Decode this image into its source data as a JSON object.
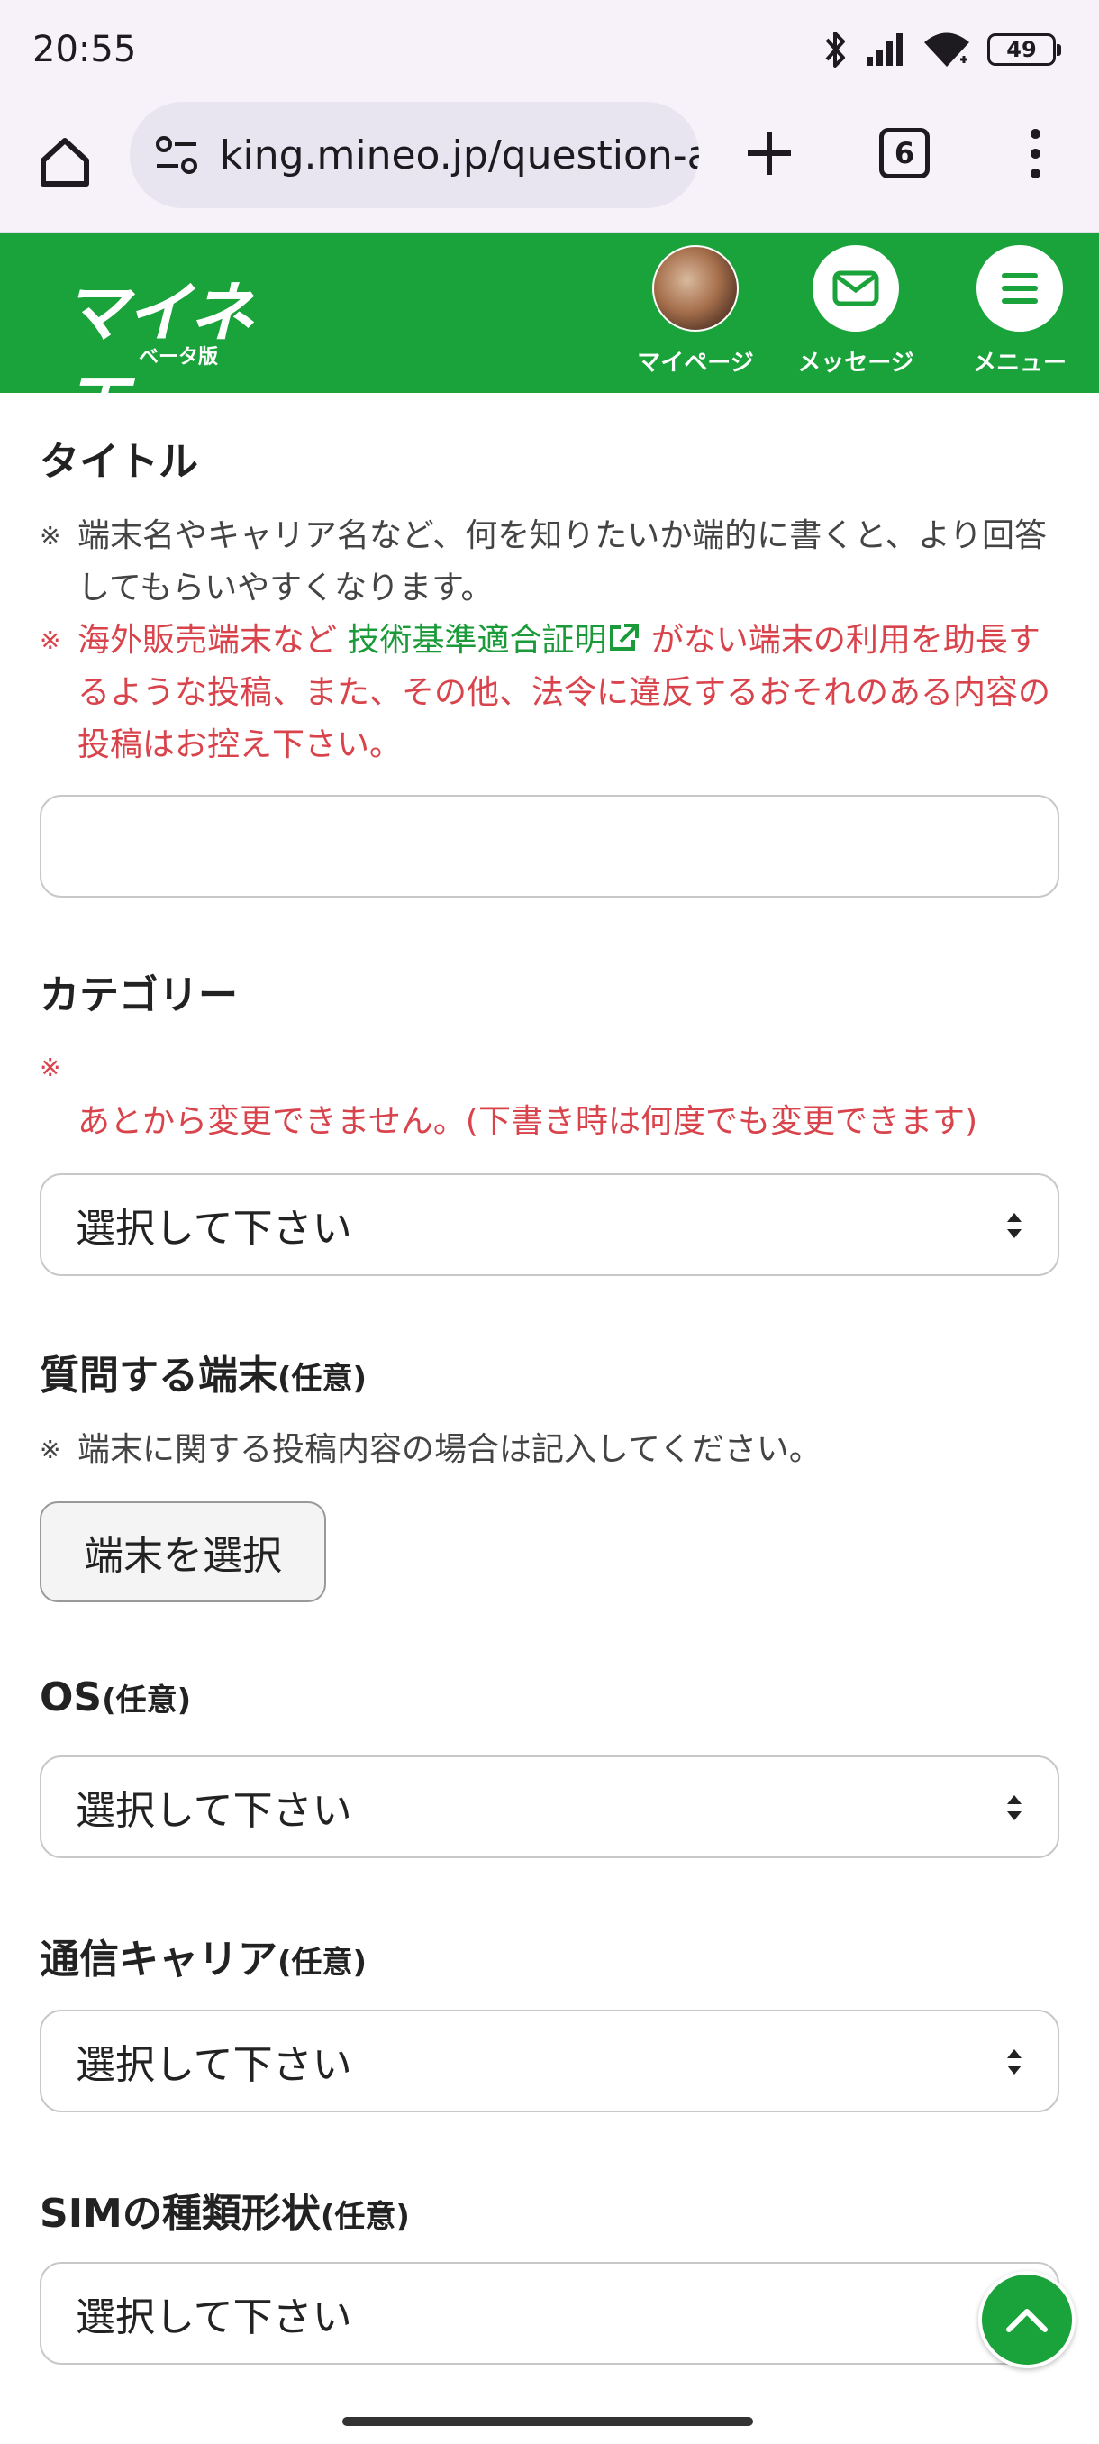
{
  "status_bar": {
    "time": "20:55",
    "battery": "49",
    "icons": [
      "bluetooth-icon",
      "signal-icon",
      "wifi-icon",
      "battery-icon"
    ]
  },
  "browser": {
    "url": "king.mineo.jp/question-a",
    "tab_count": "6"
  },
  "header": {
    "logo_text": "マイネ王",
    "logo_sub": "ベータ版",
    "nav": [
      {
        "label": "マイページ",
        "icon": "avatar"
      },
      {
        "label": "メッセージ",
        "icon": "envelope-icon"
      },
      {
        "label": "メニュー",
        "icon": "hamburger-icon"
      }
    ]
  },
  "form": {
    "title_section": {
      "heading": "タイトル",
      "note1": "端末名やキャリア名など、何を知りたいか端的に書くと、より回答してもらいやすくなります。",
      "note2_before": "海外販売端末など ",
      "note2_link": "技術基準適合証明",
      "note2_after": " がない端末の利用を助長するような投稿、また、その他、法令に違反するおそれのある内容の投稿はお控え下さい。",
      "mark": "※"
    },
    "category_section": {
      "heading": "カテゴリー",
      "mark": "※",
      "note": "あとから変更できません。(下書き時は何度でも変更できます)",
      "select_value": "選択して下さい"
    },
    "device_section": {
      "heading": "質問する端末",
      "optional": "(任意)",
      "mark": "※",
      "note": "端末に関する投稿内容の場合は記入してください。",
      "button_label": "端末を選択"
    },
    "os_section": {
      "heading": "OS",
      "optional": "(任意)",
      "select_value": "選択して下さい"
    },
    "carrier_section": {
      "heading": "通信キャリア",
      "optional": "(任意)",
      "select_value": "選択して下さい"
    },
    "sim_section": {
      "heading": "SIMの種類形状",
      "optional": "(任意)",
      "select_value": "選択して下さい"
    }
  },
  "colors": {
    "brand_green": "#1aa33a",
    "warning_red": "#d9434b",
    "link_green": "#1a9a38"
  }
}
